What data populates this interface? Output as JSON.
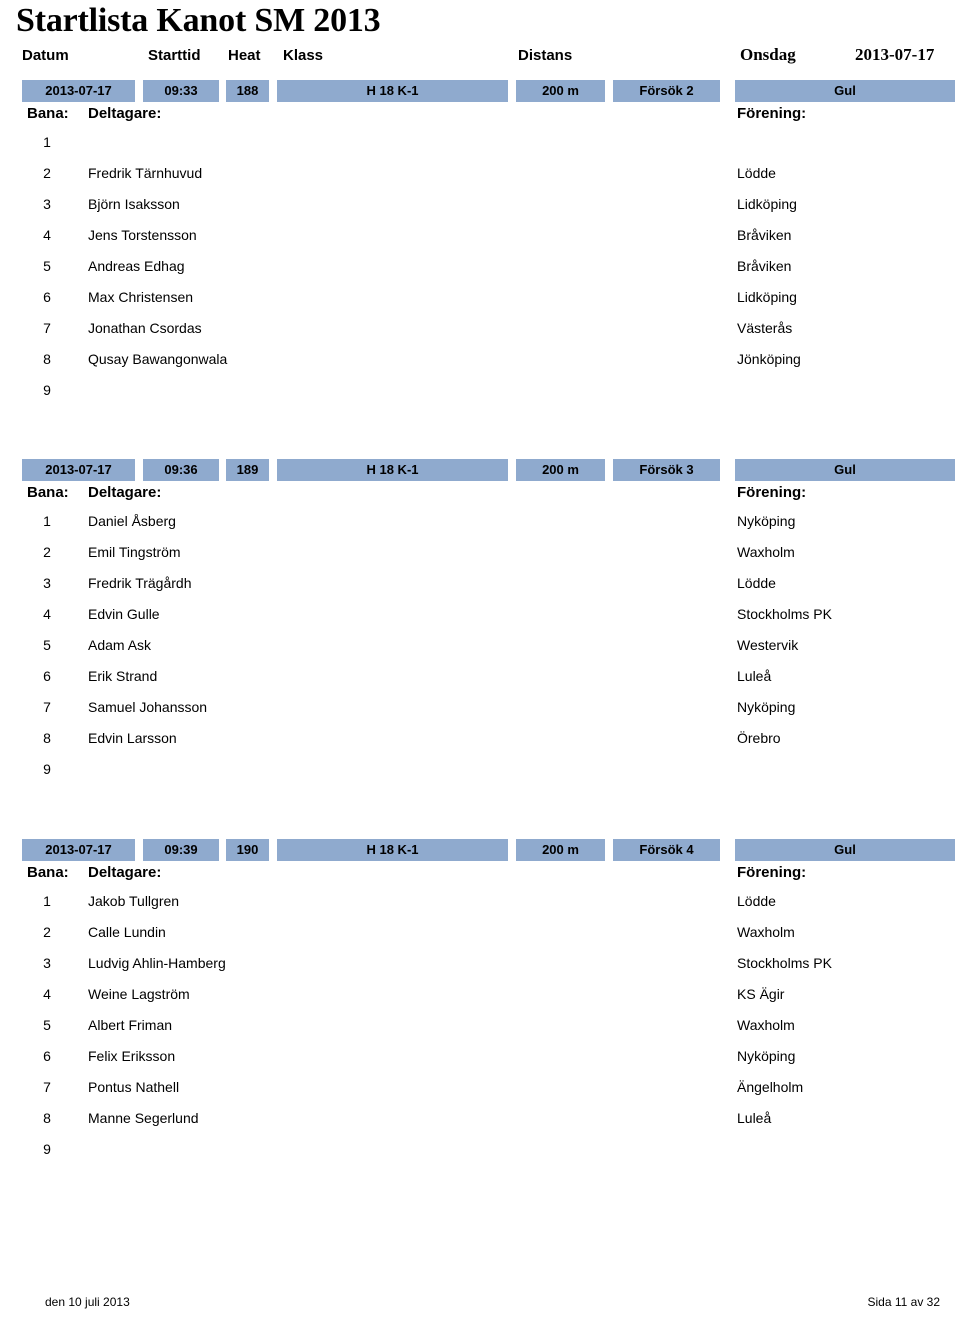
{
  "document": {
    "title": "Startlista Kanot SM 2013",
    "accent_color": "#8faace",
    "text_color": "#000000",
    "background_color": "#ffffff"
  },
  "column_labels": {
    "datum": "Datum",
    "starttid": "Starttid",
    "heat": "Heat",
    "klass": "Klass",
    "distans": "Distans",
    "weekday": "Onsdag",
    "date": "2013-07-17"
  },
  "sub_headers": {
    "lane": "Bana:",
    "participant": "Deltagare:",
    "club": "Förening:"
  },
  "heats": [
    {
      "date": "2013-07-17",
      "time": "09:33",
      "heat": "188",
      "klass": "H 18  K-1",
      "distance": "200 m",
      "round": "Försök 2",
      "group": "Gul",
      "participants": [
        {
          "lane": "1",
          "name": "",
          "club": ""
        },
        {
          "lane": "2",
          "name": "Fredrik Tärnhuvud",
          "club": "Lödde"
        },
        {
          "lane": "3",
          "name": "Björn Isaksson",
          "club": "Lidköping"
        },
        {
          "lane": "4",
          "name": "Jens Torstensson",
          "club": "Bråviken"
        },
        {
          "lane": "5",
          "name": "Andreas Edhag",
          "club": "Bråviken"
        },
        {
          "lane": "6",
          "name": "Max Christensen",
          "club": "Lidköping"
        },
        {
          "lane": "7",
          "name": "Jonathan Csordas",
          "club": "Västerås"
        },
        {
          "lane": "8",
          "name": "Qusay Bawangonwala",
          "club": "Jönköping"
        },
        {
          "lane": "9",
          "name": "",
          "club": ""
        }
      ]
    },
    {
      "date": "2013-07-17",
      "time": "09:36",
      "heat": "189",
      "klass": "H 18  K-1",
      "distance": "200 m",
      "round": "Försök 3",
      "group": "Gul",
      "participants": [
        {
          "lane": "1",
          "name": "Daniel Åsberg",
          "club": "Nyköping"
        },
        {
          "lane": "2",
          "name": "Emil Tingström",
          "club": "Waxholm"
        },
        {
          "lane": "3",
          "name": "Fredrik Trägårdh",
          "club": "Lödde"
        },
        {
          "lane": "4",
          "name": "Edvin Gulle",
          "club": "Stockholms PK"
        },
        {
          "lane": "5",
          "name": "Adam Ask",
          "club": "Westervik"
        },
        {
          "lane": "6",
          "name": "Erik Strand",
          "club": "Luleå"
        },
        {
          "lane": "7",
          "name": "Samuel Johansson",
          "club": "Nyköping"
        },
        {
          "lane": "8",
          "name": "Edvin Larsson",
          "club": "Örebro"
        },
        {
          "lane": "9",
          "name": "",
          "club": ""
        }
      ]
    },
    {
      "date": "2013-07-17",
      "time": "09:39",
      "heat": "190",
      "klass": "H 18  K-1",
      "distance": "200 m",
      "round": "Försök 4",
      "group": "Gul",
      "participants": [
        {
          "lane": "1",
          "name": "Jakob Tullgren",
          "club": "Lödde"
        },
        {
          "lane": "2",
          "name": "Calle  Lundin",
          "club": "Waxholm"
        },
        {
          "lane": "3",
          "name": "Ludvig Ahlin-Hamberg",
          "club": "Stockholms PK"
        },
        {
          "lane": "4",
          "name": "Weine Lagström",
          "club": "KS Ägir"
        },
        {
          "lane": "5",
          "name": "Albert  Friman",
          "club": "Waxholm"
        },
        {
          "lane": "6",
          "name": "Felix Eriksson",
          "club": "Nyköping"
        },
        {
          "lane": "7",
          "name": "Pontus Nathell",
          "club": "Ängelholm"
        },
        {
          "lane": "8",
          "name": "Manne  Segerlund",
          "club": "Luleå"
        },
        {
          "lane": "9",
          "name": "",
          "club": ""
        }
      ]
    }
  ],
  "footer": {
    "left": "den 10 juli 2013",
    "right": "Sida 11 av 32"
  }
}
